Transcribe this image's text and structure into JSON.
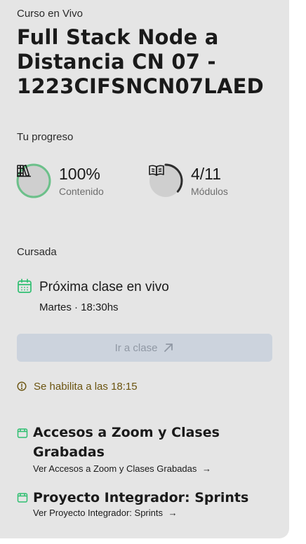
{
  "course": {
    "eyebrow": "Curso en Vivo",
    "title": "Full Stack Node a Distancia CN 07 - 1223CIFSNCN07LAED"
  },
  "progress": {
    "heading": "Tu progreso",
    "content": {
      "value": "100%",
      "label": "Contenido",
      "fraction": 1.0,
      "icon": "books-icon"
    },
    "modules": {
      "value": "4/11",
      "label": "Módulos",
      "fraction": 0.3636,
      "icon": "open-book-icon"
    }
  },
  "cursada": {
    "heading": "Cursada",
    "next_class": {
      "icon": "calendar-icon",
      "title": "Próxima clase en vivo",
      "schedule": "Martes · 18:30hs"
    },
    "button": {
      "label": "Ir a clase",
      "icon": "arrow-up-right-icon",
      "enabled": false
    },
    "notice": {
      "icon": "clock-icon",
      "text": "Se habilita a las 18:15"
    }
  },
  "links": [
    {
      "icon": "window-icon",
      "title": "Accesos a Zoom y Clases Grabadas",
      "sub": "Ver Accesos a Zoom y Clases Grabadas"
    },
    {
      "icon": "window-icon",
      "title": "Proyecto Integrador: Sprints",
      "sub": "Ver Proyecto Integrador: Sprints"
    }
  ],
  "colors": {
    "card": "#e5e5e5",
    "ring_green": "#6cc08a",
    "ring_dark": "#2e2e2e",
    "accent_green": "#2fbf71",
    "notice": "#6b5410",
    "button_disabled": "#ccd3dd"
  }
}
